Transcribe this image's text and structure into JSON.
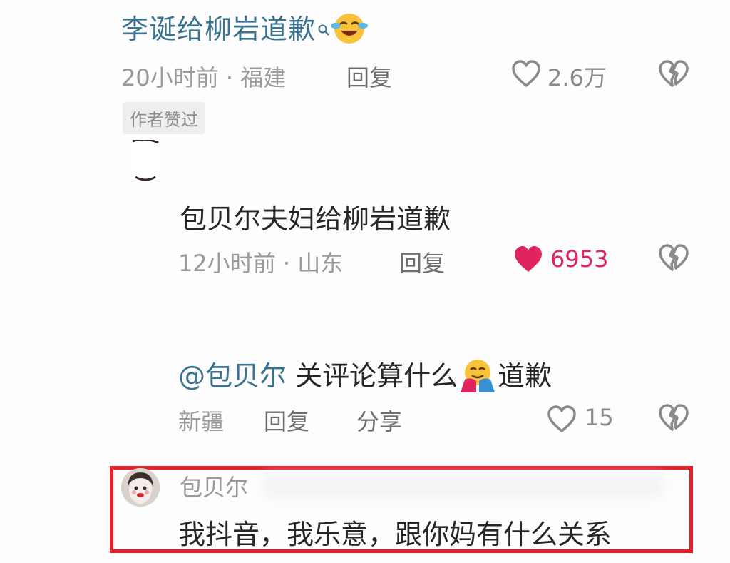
{
  "top_comment": {
    "title": "李诞给柳岩道歉",
    "time": "20小时前",
    "separator": "·",
    "location": "福建",
    "reply_label": "回复",
    "like_count": "2.6万",
    "badge": "作者赞过"
  },
  "reply1": {
    "text": "包贝尔夫妇给柳岩道歉",
    "time": "12小时前",
    "separator": "·",
    "location": "山东",
    "reply_label": "回复",
    "like_count": "6953"
  },
  "reply2": {
    "mention": "@包贝尔",
    "text_before_emoji": " 关评论算什么",
    "text_after_emoji": "道歉",
    "location": "新疆",
    "reply_label": "回复",
    "share_label": "分享",
    "like_count": "15"
  },
  "highlighted_comment": {
    "username": "包贝尔",
    "text": "我抖音，我乐意，跟你妈有什么关系"
  },
  "icons": {
    "heart": "heart-outline-icon",
    "heart_liked": "heart-filled-icon",
    "dislike": "broken-heart-icon",
    "search": "search-icon"
  },
  "colors": {
    "link": "#3a7390",
    "liked": "#e0245e",
    "highlight_border": "#e8202a"
  }
}
